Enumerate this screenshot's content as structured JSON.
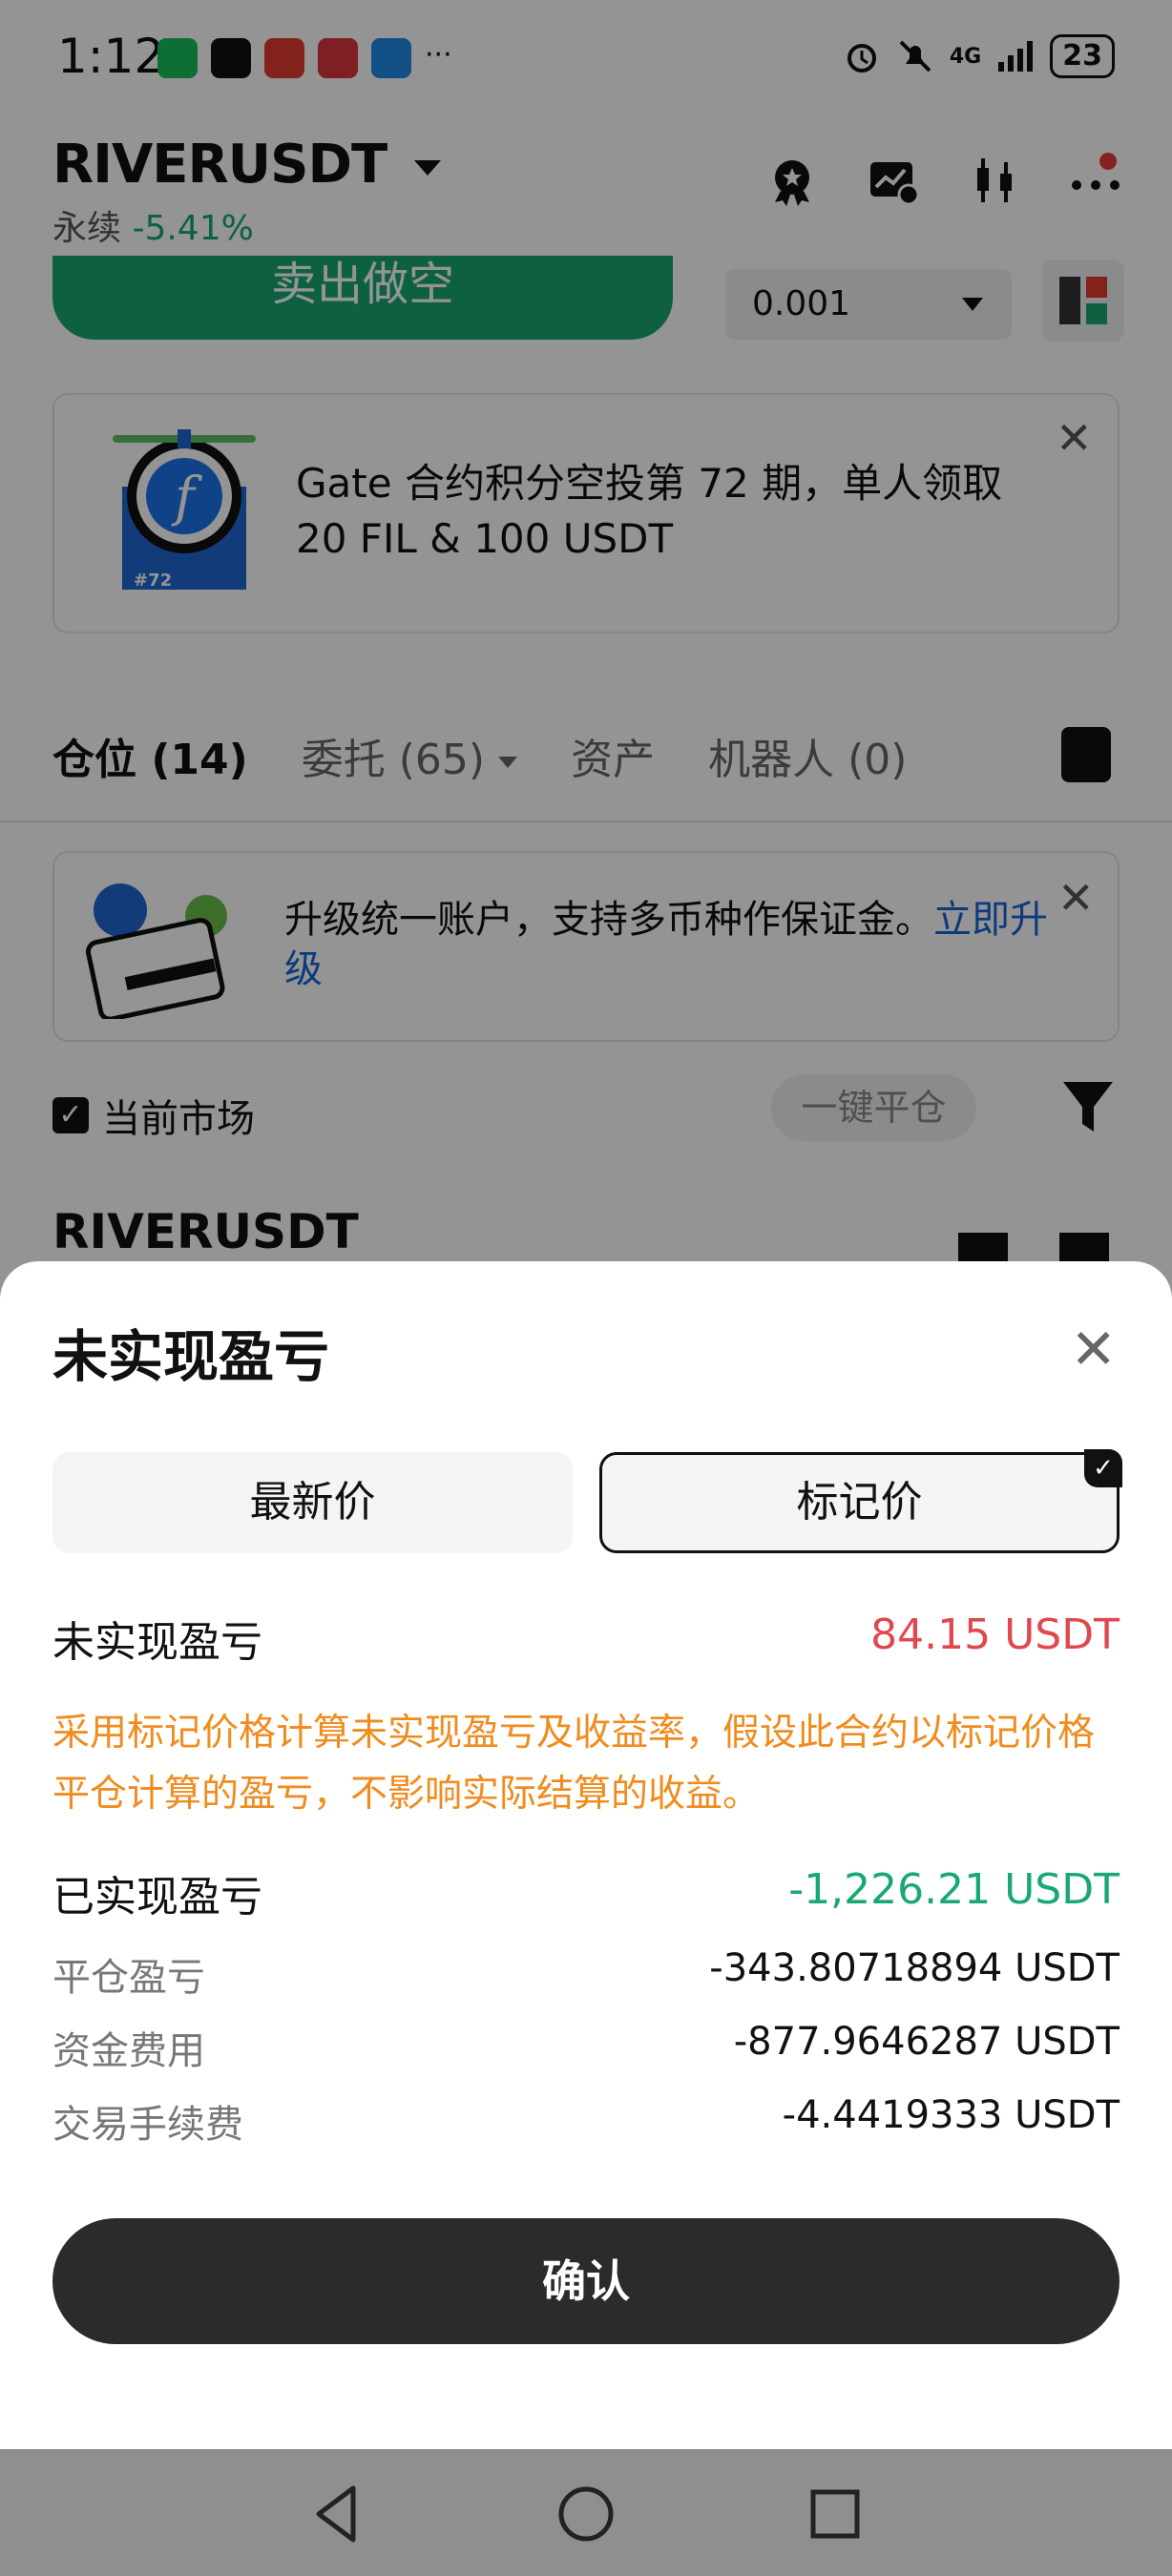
{
  "status": {
    "time": "1:12",
    "more": "···",
    "network": "4G",
    "battery": "23"
  },
  "header": {
    "pair": "RIVERUSDT",
    "perp_label": "永续",
    "change": "-5.41%"
  },
  "trade": {
    "sell_label": "卖出做空",
    "quantity": "0.001"
  },
  "promo": {
    "badge": "#72",
    "text": "Gate 合约积分空投第 72 期，单人领取 20 FIL & 100 USDT"
  },
  "tabs": [
    {
      "label": "仓位 (14)"
    },
    {
      "label": "委托 (65)"
    },
    {
      "label": "资产"
    },
    {
      "label": "机器人 (0)"
    }
  ],
  "upgrade": {
    "text": "升级统一账户，支持多币种作保证金。",
    "link": "立即升级"
  },
  "filter": {
    "current_market": "当前市场",
    "close_all": "一键平仓"
  },
  "position": {
    "pair": "RIVERUSDT"
  },
  "sheet": {
    "title": "未实现盈亏",
    "options": [
      "最新价",
      "标记价"
    ],
    "selected_option": "标记价",
    "unrealized_label": "未实现盈亏",
    "unrealized_value": "84.15 USDT",
    "note": "采用标记价格计算未实现盈亏及收益率，假设此合约以标记价格平仓计算的盈亏，不影响实际结算的收益。",
    "realized_label": "已实现盈亏",
    "realized_value": "-1,226.21 USDT",
    "details": [
      {
        "label": "平仓盈亏",
        "value": "-343.80718894 USDT"
      },
      {
        "label": "资金费用",
        "value": "-877.9646287 USDT"
      },
      {
        "label": "交易手续费",
        "value": "-4.4419333 USDT"
      }
    ],
    "confirm_label": "确认"
  },
  "colors": {
    "green": "#18a871",
    "red": "#e0484f",
    "orange": "#f08c1f",
    "link": "#1565d8",
    "dark_button": "#2b2b2d"
  }
}
